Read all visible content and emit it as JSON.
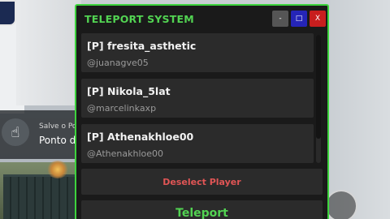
{
  "window": {
    "title": "TELEPORT SYSTEM",
    "controls": {
      "minimize_label": "-",
      "maximize_label": "□",
      "close_label": "X"
    },
    "colors": {
      "accent": "#52d352",
      "border": "#3dd43d",
      "danger": "#e05555",
      "minimize": "#555555",
      "maximize": "#2525b8",
      "close": "#c81e1e"
    }
  },
  "players": [
    {
      "name": "[P] fresita_asthetic",
      "handle": "@juanagve05"
    },
    {
      "name": "[P] Nikola_5lat",
      "handle": "@marcelinkaxp"
    },
    {
      "name": "[P] Athenakhloe00",
      "handle": "@Athenakhloe00"
    }
  ],
  "actions": {
    "deselect_label": "Deselect Player",
    "teleport_label": "Teleport"
  },
  "notification": {
    "icon": "hand-pointer-icon",
    "title": "Salve o Po",
    "subtitle": "Ponto d"
  }
}
